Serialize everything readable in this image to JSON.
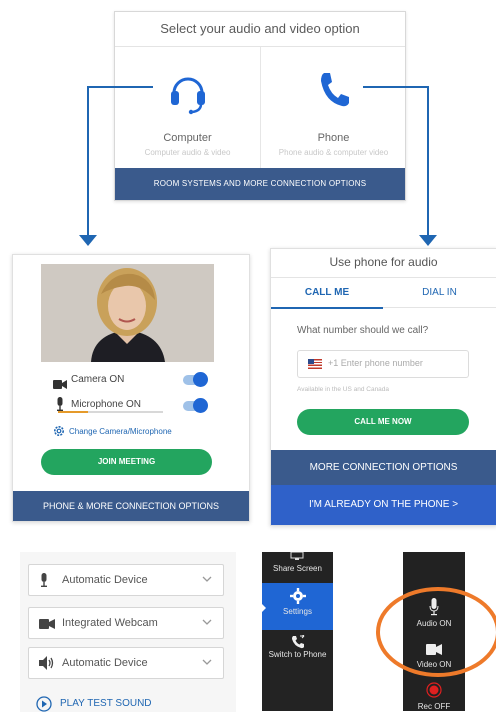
{
  "selector": {
    "title": "Select your audio and video option",
    "options": [
      {
        "name": "Computer",
        "sub": "Computer audio & video",
        "icon": "headset-icon"
      },
      {
        "name": "Phone",
        "sub": "Phone audio & computer video",
        "icon": "phone-icon"
      }
    ],
    "more_button": "ROOM SYSTEMS AND MORE CONNECTION OPTIONS"
  },
  "computer_panel": {
    "camera_label": "Camera ON",
    "microphone_label": "Microphone ON",
    "change_link": "Change Camera/Microphone",
    "join_button": "JOIN MEETING",
    "more_button": "PHONE & MORE CONNECTION OPTIONS",
    "camera_on": true,
    "microphone_on": true
  },
  "phone_panel": {
    "title": "Use phone for audio",
    "tabs": [
      "CALL ME",
      "DIAL IN"
    ],
    "active_tab": "CALL ME",
    "question": "What number should we call?",
    "country_code": "+1",
    "phone_placeholder": "Enter phone number",
    "availability": "Available in the US and Canada",
    "call_button": "CALL ME NOW",
    "more_button": "MORE CONNECTION OPTIONS",
    "already_button": "I'M ALREADY ON THE PHONE >"
  },
  "device_settings": {
    "devices": [
      {
        "label": "Automatic Device",
        "icon": "microphone-icon"
      },
      {
        "label": "Integrated Webcam",
        "icon": "camera-icon"
      },
      {
        "label": "Automatic Device",
        "icon": "speaker-icon"
      }
    ],
    "play_test": "PLAY TEST SOUND"
  },
  "sidebar": {
    "items": [
      "Share Screen",
      "Settings",
      "Switch to Phone"
    ],
    "active": "Settings"
  },
  "controls": {
    "items": [
      "Audio ON",
      "Video ON",
      "Rec OFF"
    ]
  },
  "colors": {
    "accent": "#1f66b2",
    "green": "#23a55f",
    "navy_bar": "#3a5a8c",
    "highlight_ring": "#ee7a2a"
  }
}
